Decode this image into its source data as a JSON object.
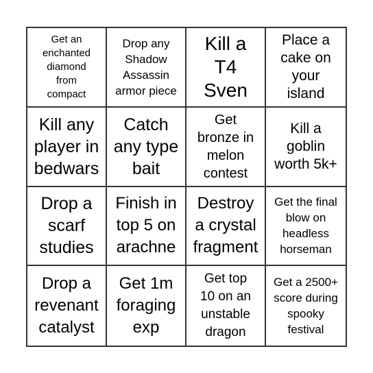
{
  "board": {
    "cells": [
      "Get an\nenchanted\ndiamond\nfrom\ncompact",
      "Drop any\nShadow\nAssassin\narmor piece",
      "Kill a\nT4\nSven",
      "Place a\ncake on\nyour\nisland",
      "Kill any\nplayer in\nbedwars",
      "Catch\nany type\nbait",
      "Get\nbronze in\nmelon\ncontest",
      "Kill a\ngoblin\nworth 5k+",
      "Drop a\nscarf\nstudies",
      "Finish in\ntop 5 on\narachne",
      "Destroy\na crystal\nfragment",
      "Get the final\nblow on\nheadless\nhorseman",
      "Drop a\nrevenant\ncatalyst",
      "Get 1m\nforaging\nexp",
      "Get top\n10 on an\nunstable\ndragon",
      "Get a 2500+\nscore during\nspooky\nfestival"
    ]
  }
}
